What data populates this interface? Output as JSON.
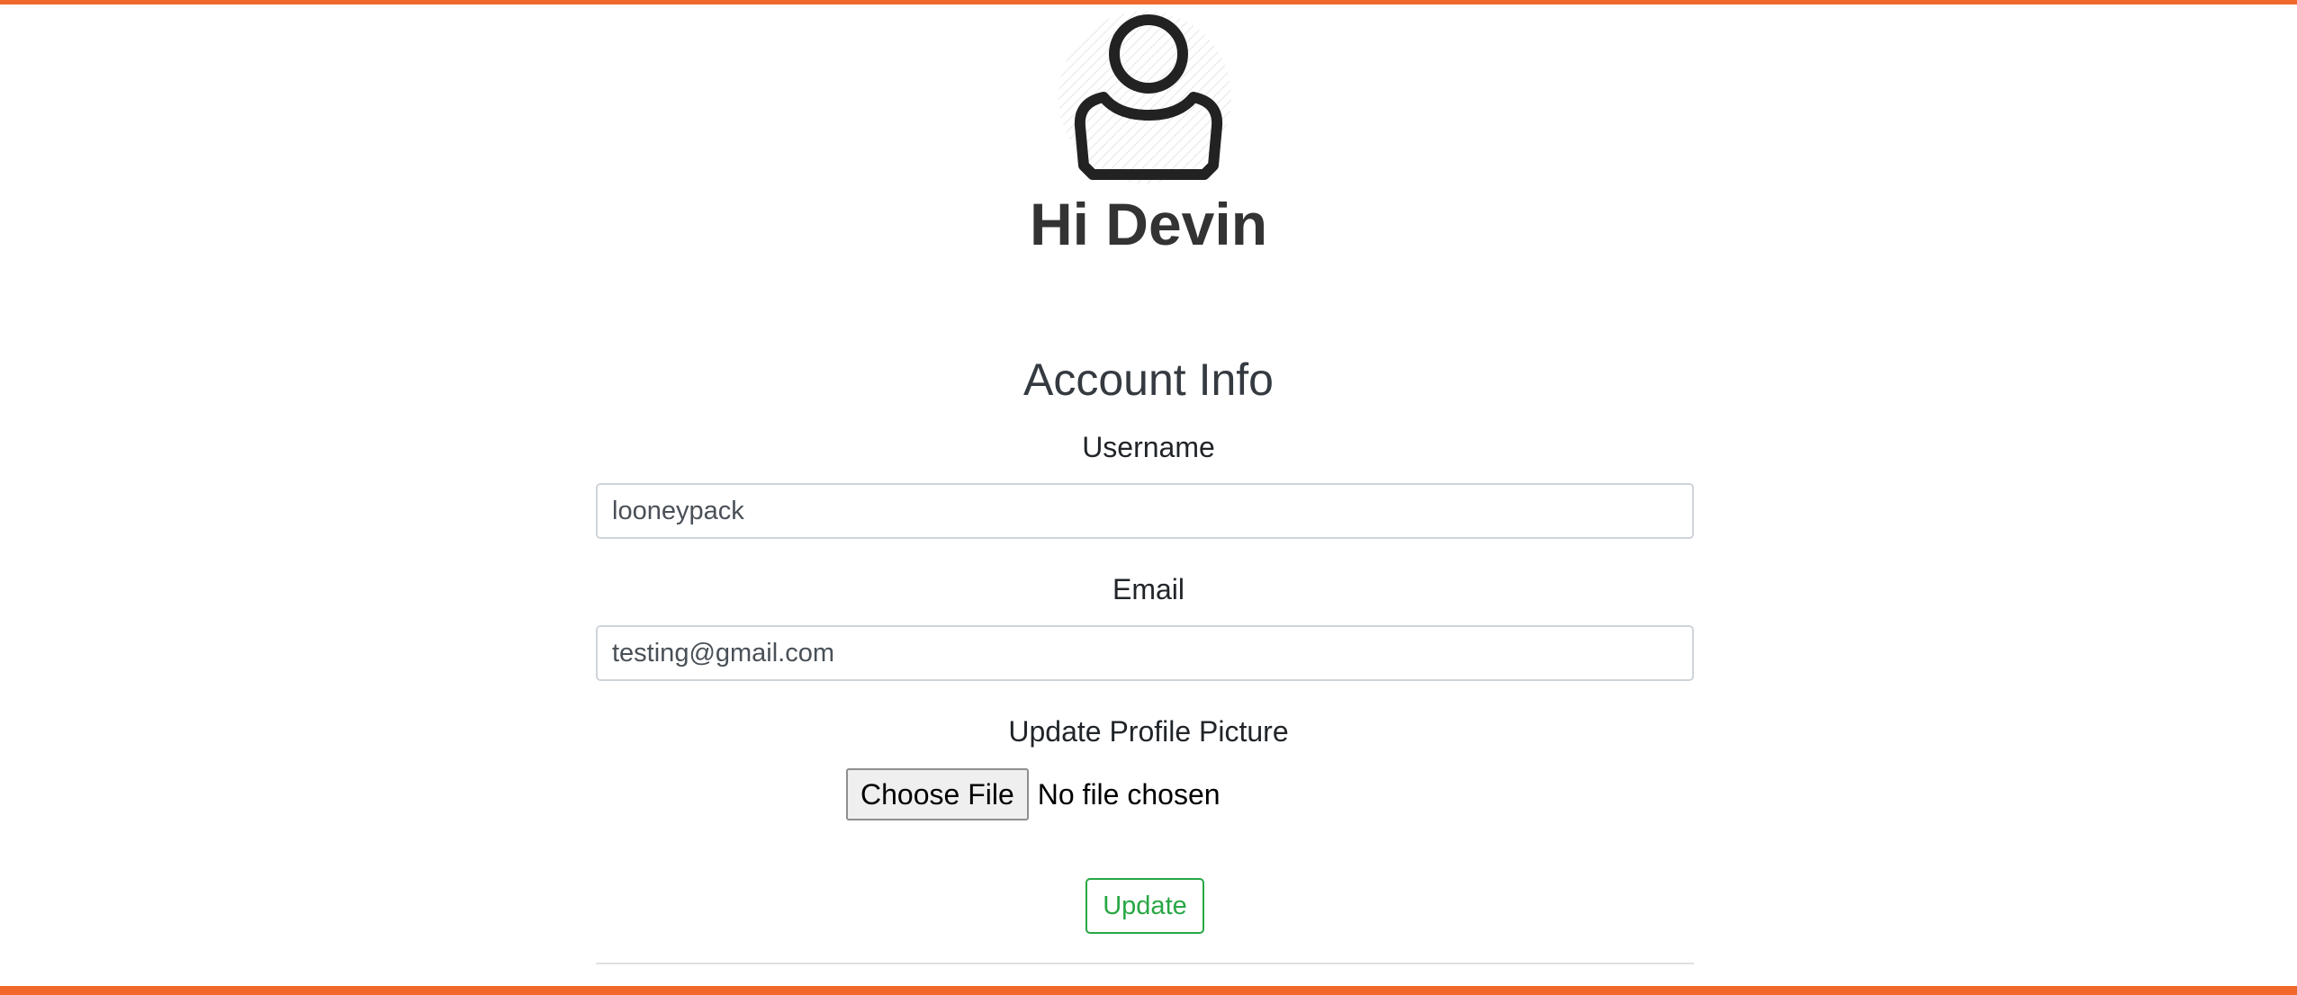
{
  "profile": {
    "greeting": "Hi Devin",
    "avatar_icon": "user-silhouette-icon"
  },
  "account": {
    "section_title": "Account Info",
    "username_label": "Username",
    "username_value": "looneypack",
    "email_label": "Email",
    "email_value": "testing@gmail.com",
    "picture_label": "Update Profile Picture",
    "file_button_label": "Choose File",
    "file_status": "No file chosen",
    "update_label": "Update"
  },
  "colors": {
    "accent_border": "#f0692b",
    "update_button": "#28a745"
  }
}
